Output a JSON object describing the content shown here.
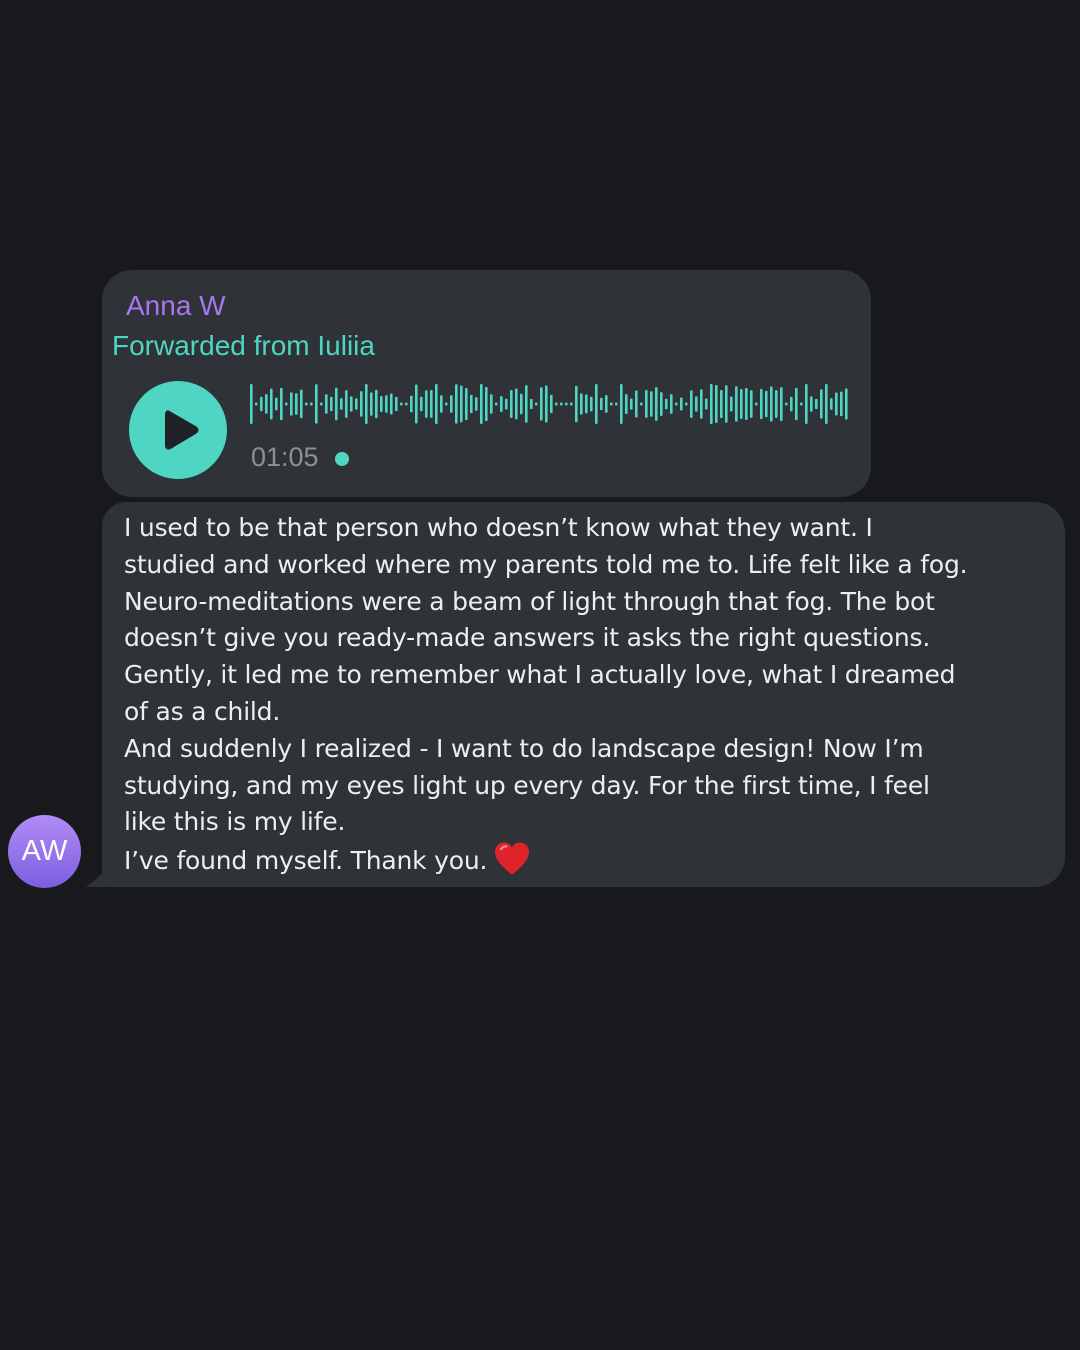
{
  "message": {
    "sender_name": "Anna W",
    "forwarded_label": "Forwarded from Iuliia",
    "voice": {
      "duration": "01:05",
      "play_icon": "play-icon",
      "unplayed_indicator": true,
      "accent_color": "#4fd6c2"
    },
    "text_lines": [
      "I used to be that person who doesn’t know what they want. I",
      "studied and worked where my parents told me to. Life felt like a fog.",
      "Neuro-meditations were a beam of light through that fog. The bot",
      "doesn’t give you ready-made answers it asks the right questions.",
      "Gently, it led me to remember what I actually love, what I dreamed",
      "of as a child.",
      "And suddenly I realized - I want to do landscape design!  Now I’m",
      "studying, and my eyes light up every day. For the first time, I feel",
      "like this is my life.",
      "I’ve found myself. Thank you."
    ],
    "emoji": "red-heart-icon"
  },
  "avatar": {
    "initials": "AW"
  },
  "colors": {
    "background": "#18191d",
    "bubble": "#2f3237",
    "sender_name": "#a578f0",
    "forwarded": "#4fd6c2"
  }
}
